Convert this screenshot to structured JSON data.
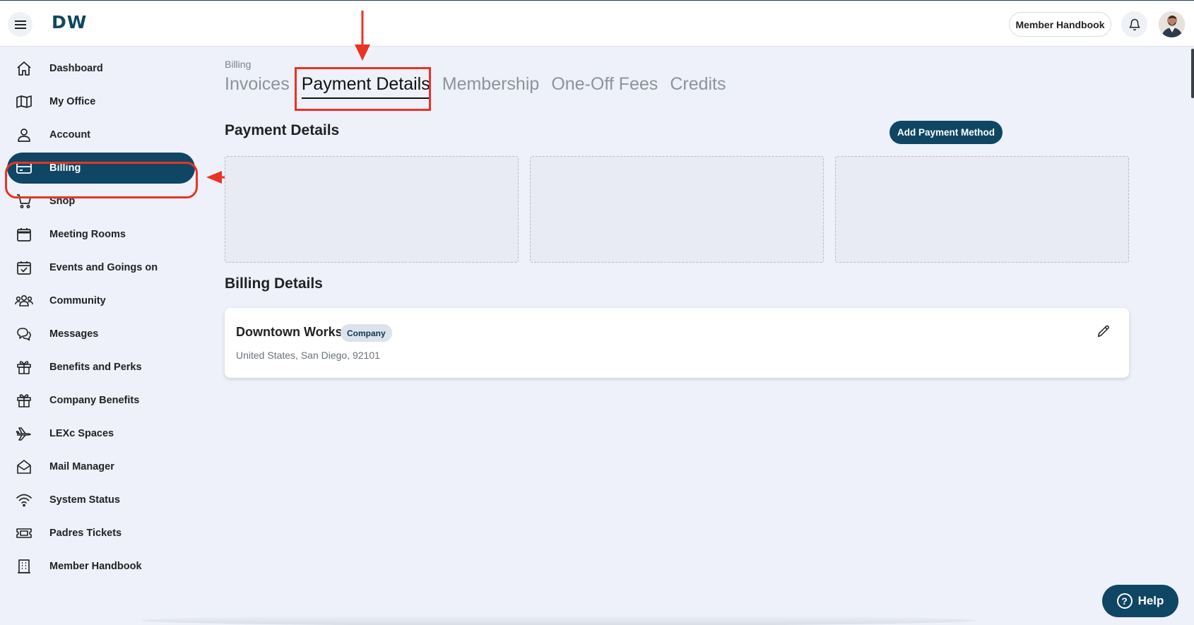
{
  "brand": {
    "logo_text": "DW",
    "primary_color": "#0f4664"
  },
  "header": {
    "member_handbook_button": "Member Handbook"
  },
  "sidebar": {
    "items": [
      {
        "label": "Dashboard",
        "icon": "home-icon"
      },
      {
        "label": "My Office",
        "icon": "map-icon"
      },
      {
        "label": "Account",
        "icon": "user-icon"
      },
      {
        "label": "Billing",
        "icon": "credit-card-icon",
        "active": true
      },
      {
        "label": "Shop",
        "icon": "cart-icon"
      },
      {
        "label": "Meeting Rooms",
        "icon": "calendar-icon"
      },
      {
        "label": "Events and Goings on",
        "icon": "calendar-check-icon"
      },
      {
        "label": "Community",
        "icon": "users-icon"
      },
      {
        "label": "Messages",
        "icon": "chat-icon"
      },
      {
        "label": "Benefits and Perks",
        "icon": "gift-icon"
      },
      {
        "label": "Company Benefits",
        "icon": "gift-icon"
      },
      {
        "label": "LEXc Spaces",
        "icon": "plane-icon"
      },
      {
        "label": "Mail Manager",
        "icon": "mail-open-icon"
      },
      {
        "label": "System Status",
        "icon": "wifi-icon"
      },
      {
        "label": "Padres Tickets",
        "icon": "ticket-icon"
      },
      {
        "label": "Member Handbook",
        "icon": "building-icon"
      }
    ]
  },
  "main": {
    "breadcrumb": "Billing",
    "tabs": [
      {
        "label": "Invoices"
      },
      {
        "label": "Payment Details",
        "active": true
      },
      {
        "label": "Membership"
      },
      {
        "label": "One-Off Fees"
      },
      {
        "label": "Credits"
      }
    ],
    "payment_details_title": "Payment Details",
    "add_payment_method_button": "Add Payment Method",
    "billing_details_title": "Billing Details",
    "billing_card": {
      "name": "Downtown Works",
      "badge": "Company",
      "address": "United States, San Diego, 92101"
    }
  },
  "help_button": "Help",
  "annotation_color": "#ea3323"
}
